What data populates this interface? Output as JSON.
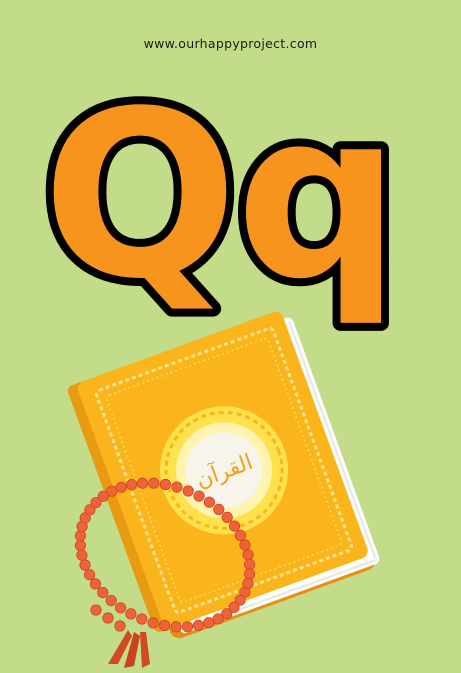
{
  "card": {
    "website": "www.ourhappyproject.com",
    "letters": {
      "upper": "Q",
      "lower": "q"
    },
    "book_label": "القرآن"
  },
  "colors": {
    "background": "#c3dc8a",
    "letter_fill": "#f7941d",
    "letter_outline": "#000000",
    "book_cover": "#f9b51b",
    "book_spine": "#e79a12",
    "book_pages": "#ffffff",
    "medallion": "#ffe14d",
    "beads": "#f0623a",
    "tassel": "#d24a22"
  },
  "icons": [
    "quran-book-icon",
    "prayer-beads-icon"
  ]
}
